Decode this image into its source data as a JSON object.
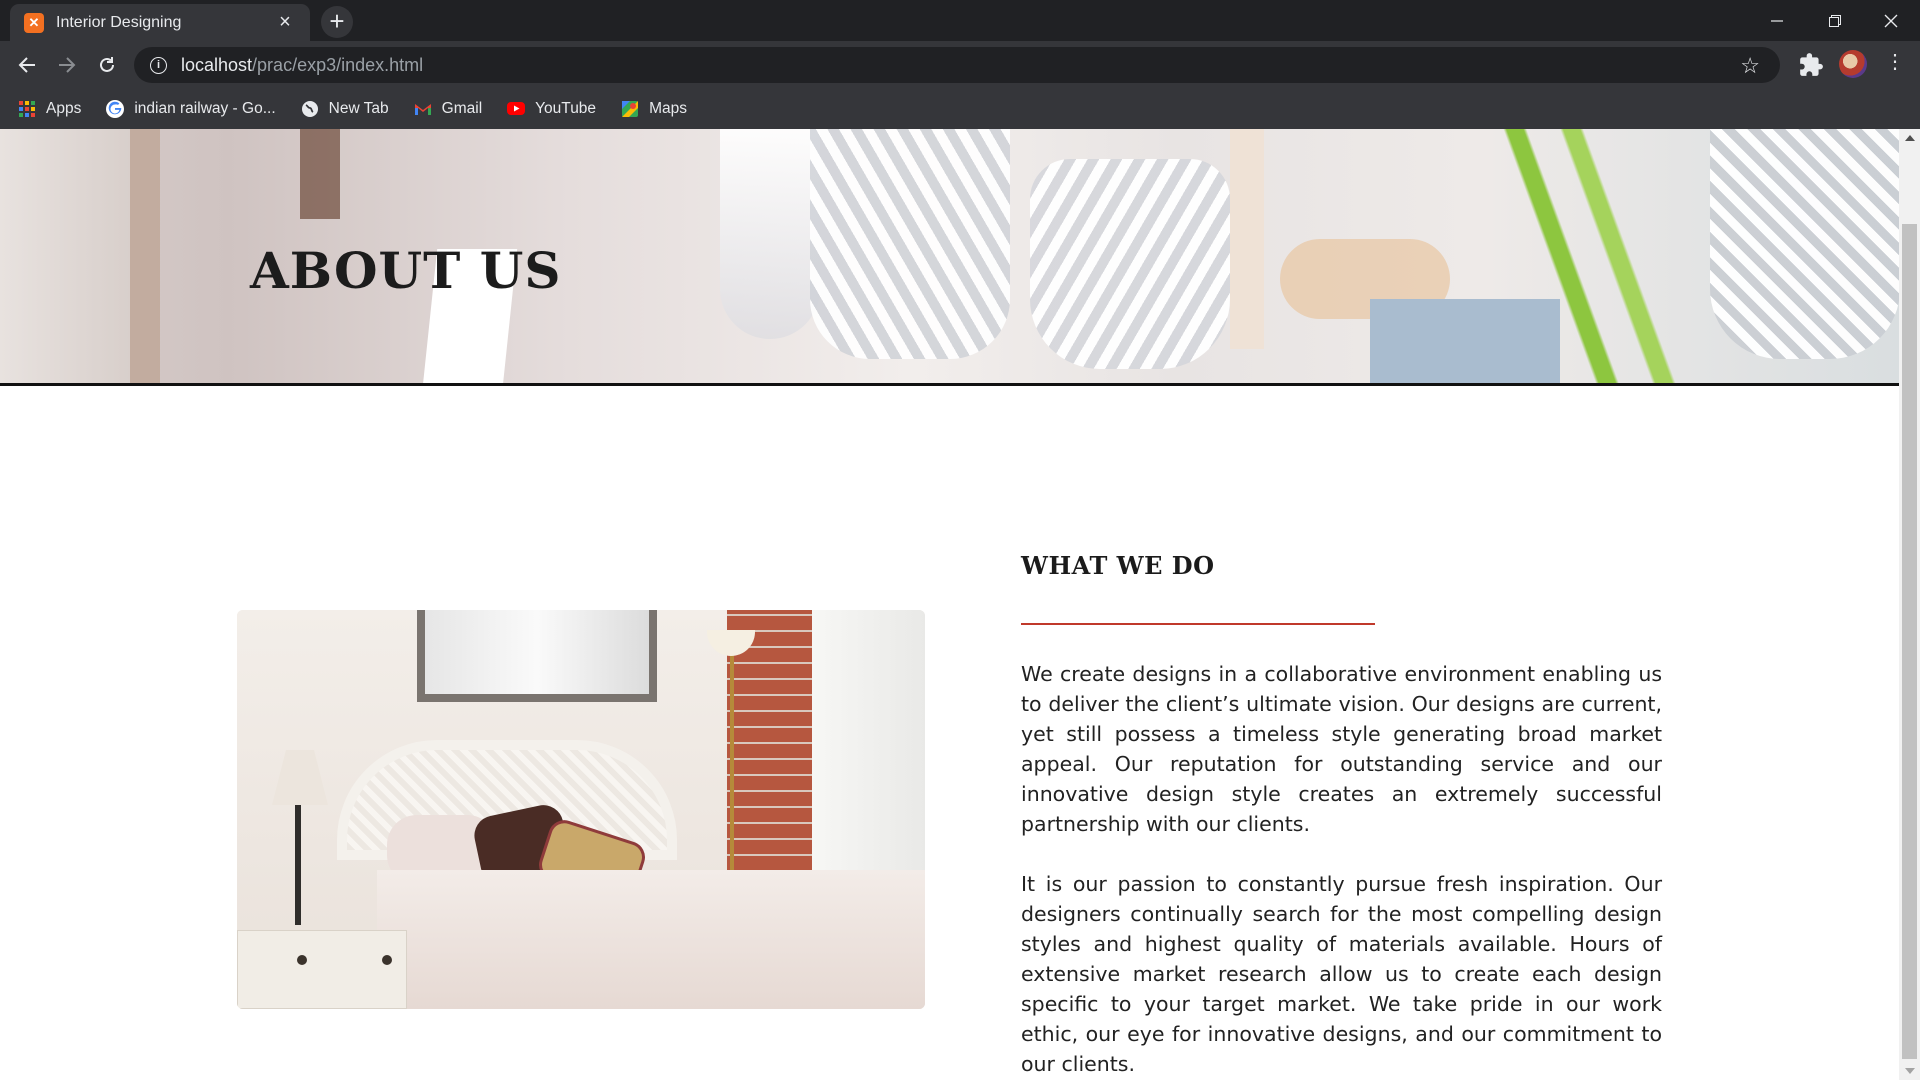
{
  "browser": {
    "tab_title": "Interior Designing",
    "tab_favicon": "xampp-icon",
    "new_tab": "+",
    "window_controls": [
      "minimize-icon",
      "restore-icon",
      "close-icon"
    ],
    "address": {
      "host": "localhost",
      "path": "/prac/exp3/index.html"
    },
    "bookmarks": [
      {
        "label": "Apps",
        "icon": "apps-grid-icon"
      },
      {
        "label": "indian railway - Go...",
        "icon": "google-icon"
      },
      {
        "label": "New Tab",
        "icon": "globe-icon"
      },
      {
        "label": "Gmail",
        "icon": "gmail-icon"
      },
      {
        "label": "YouTube",
        "icon": "youtube-icon"
      },
      {
        "label": "Maps",
        "icon": "maps-icon"
      }
    ]
  },
  "page": {
    "hero_title": "ABOUT US",
    "section_heading": "WHAT WE DO",
    "paragraphs": [
      "We create designs in a collaborative environment enabling us to deliver the client’s ultimate vision. Our designs are current, yet still possess a timeless style generating broad market appeal. Our reputation for outstanding service and our innovative design style creates an extremely successful partnership with our clients.",
      "It is our passion to constantly pursue fresh inspiration. Our designers continually search for the most compelling design styles and highest quality of materials available. Hours of extensive market research allow us to create each design specific to your target market. We take pride in our work ethic, our eye for innovative designs, and our commitment to our clients."
    ]
  },
  "colors": {
    "chrome_dark": "#202124",
    "chrome_toolbar": "#35363a",
    "accent_rule": "#c0392b",
    "heading": "#1b1b1b"
  }
}
